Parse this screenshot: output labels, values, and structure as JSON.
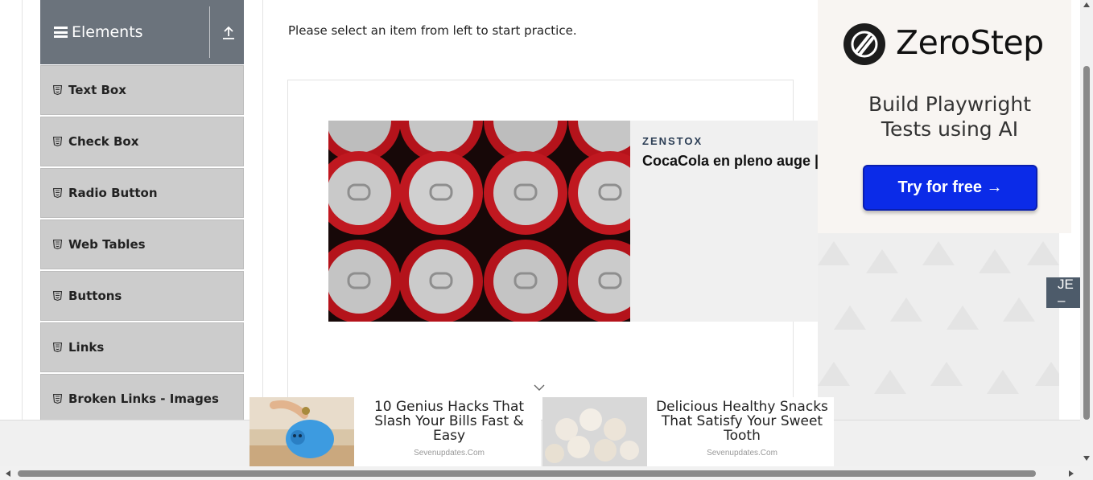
{
  "sidebar": {
    "group_title": "Elements",
    "items": [
      {
        "label": "Text Box"
      },
      {
        "label": "Check Box"
      },
      {
        "label": "Radio Button"
      },
      {
        "label": "Web Tables"
      },
      {
        "label": "Buttons"
      },
      {
        "label": "Links"
      },
      {
        "label": "Broken Links - Images"
      }
    ]
  },
  "main": {
    "intro": "Please select an item from left to start practice."
  },
  "center_ad": {
    "brand": "ZENSTOX",
    "headline": "CocaCola en pleno auge |"
  },
  "right_ad": {
    "brand": "ZeroStep",
    "tagline_line1": "Build Playwright",
    "tagline_line2": "Tests using AI",
    "cta": "Try for free →",
    "side_tab": "JE –"
  },
  "bottom_ads": [
    {
      "title": "10 Genius Hacks That Slash Your Bills Fast & Easy",
      "source": "Sevenupdates.Com"
    },
    {
      "title": "Delicious Healthy Snacks That Satisfy Your Sweet Tooth",
      "source": "Sevenupdates.Com"
    }
  ],
  "colors": {
    "group_header_bg": "#6b737c",
    "menu_item_bg": "#cccccc",
    "cta_bg": "#0b2be8"
  }
}
